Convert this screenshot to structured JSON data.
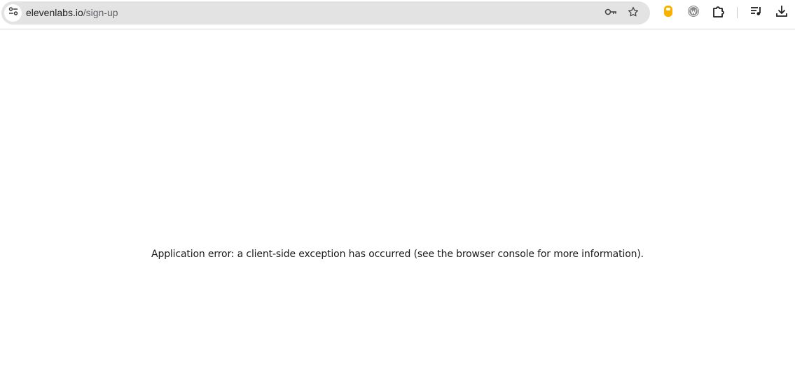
{
  "browser": {
    "url_host": "elevenlabs.io",
    "url_path": "/sign-up",
    "icons": {
      "site_info": "tune-icon",
      "password": "key-icon",
      "bookmark": "star-icon",
      "extension_1": "honey-extension-icon",
      "extension_2": "wordpress-extension-icon",
      "extensions": "puzzle-icon",
      "media": "media-queue-icon",
      "downloads": "download-icon"
    },
    "colors": {
      "omnibox_bg": "#e3e3e3",
      "extension_accent": "#f9b000"
    }
  },
  "page": {
    "error_message": "Application error: a client-side exception has occurred (see the browser console for more information)."
  }
}
